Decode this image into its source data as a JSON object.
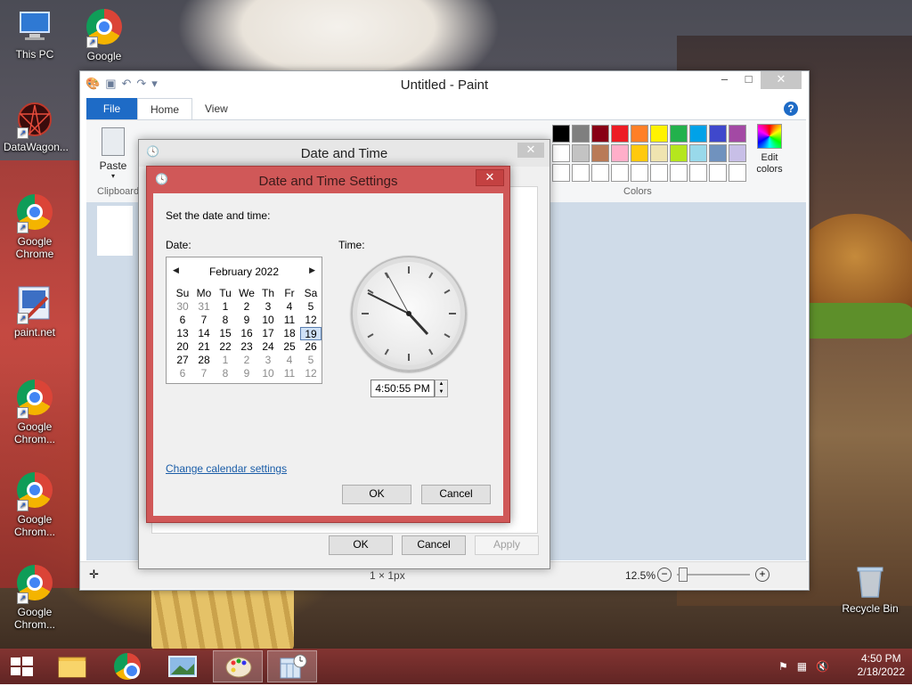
{
  "desktop": {
    "icons": [
      {
        "label": "This PC"
      },
      {
        "label": "Google Chrome"
      },
      {
        "label": "DataWagon..."
      },
      {
        "label": "Google Chrome"
      },
      {
        "label": "paint.net"
      },
      {
        "label": "Google Chrom..."
      },
      {
        "label": "Google Chrom..."
      },
      {
        "label": "Google Chrom..."
      },
      {
        "label": "Recycle Bin"
      }
    ]
  },
  "paint": {
    "title": "Untitled - Paint",
    "tabs": {
      "file": "File",
      "home": "Home",
      "view": "View"
    },
    "help": "?",
    "paste_label": "Paste",
    "clipboard_group": "Clipboard",
    "colors_group": "Colors",
    "edit_colors_label": "Edit colors",
    "palette": [
      "#000000",
      "#7f7f7f",
      "#880015",
      "#ed1c24",
      "#ff7f27",
      "#fff200",
      "#22b14c",
      "#00a2e8",
      "#3f48cc",
      "#a349a4",
      "#ffffff",
      "#c3c3c3",
      "#b97a57",
      "#ffaec9",
      "#ffc90e",
      "#efe4b0",
      "#b5e61d",
      "#99d9ea",
      "#7092be",
      "#c8bfe7",
      "#ffffff",
      "#ffffff",
      "#ffffff",
      "#ffffff",
      "#ffffff",
      "#ffffff",
      "#ffffff",
      "#ffffff",
      "#ffffff",
      "#ffffff"
    ],
    "status": {
      "size": "1 × 1px",
      "zoom": "12.5%"
    }
  },
  "dateTimeDialog": {
    "title": "Date and Time",
    "ok": "OK",
    "cancel": "Cancel",
    "apply": "Apply"
  },
  "dateTimeSettings": {
    "title": "Date and Time Settings",
    "instruction": "Set the date and time:",
    "date_label": "Date:",
    "time_label": "Time:",
    "month_year": "February 2022",
    "weekdays": [
      "Su",
      "Mo",
      "Tu",
      "We",
      "Th",
      "Fr",
      "Sa"
    ],
    "days": [
      [
        "30",
        "31",
        "1",
        "2",
        "3",
        "4",
        "5"
      ],
      [
        "6",
        "7",
        "8",
        "9",
        "10",
        "11",
        "12"
      ],
      [
        "13",
        "14",
        "15",
        "16",
        "17",
        "18",
        "19"
      ],
      [
        "20",
        "21",
        "22",
        "23",
        "24",
        "25",
        "26"
      ],
      [
        "27",
        "28",
        "1",
        "2",
        "3",
        "4",
        "5"
      ],
      [
        "6",
        "7",
        "8",
        "9",
        "10",
        "11",
        "12"
      ]
    ],
    "selected_day": "19",
    "time_value": "4:50:55 PM",
    "link": "Change calendar settings",
    "ok": "OK",
    "cancel": "Cancel"
  },
  "taskbar": {
    "time": "4:50 PM",
    "date": "2/18/2022"
  }
}
